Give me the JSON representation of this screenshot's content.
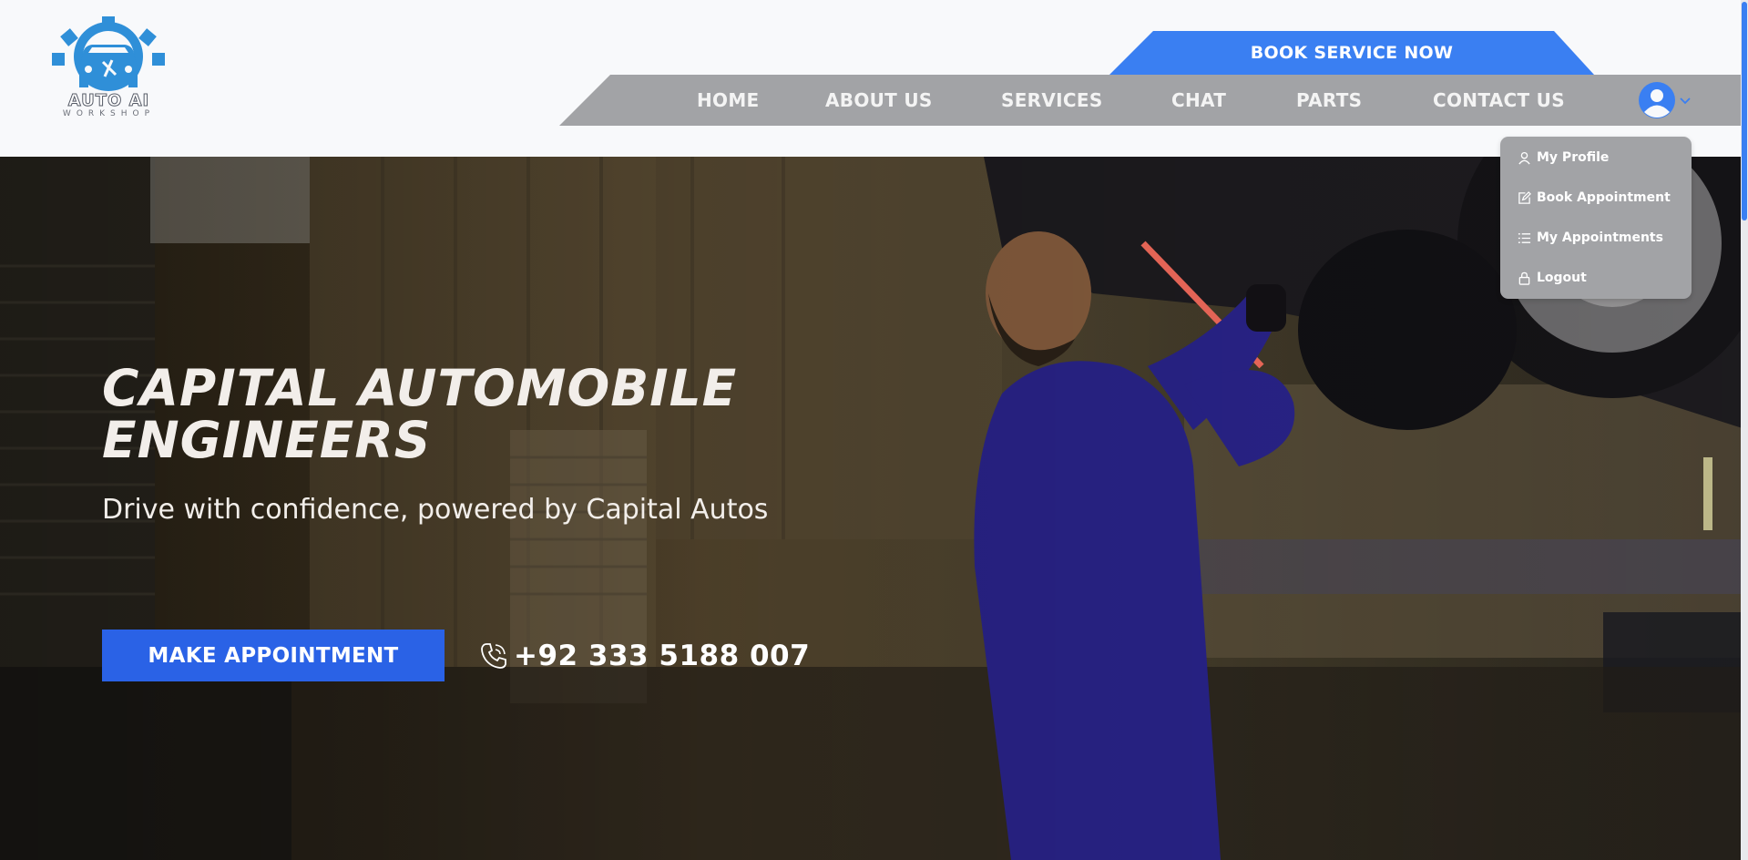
{
  "brand": {
    "name": "AUTO AI",
    "sub": "WORKSHOP",
    "accent": "#3a7ff2"
  },
  "header": {
    "cta": "BOOK SERVICE NOW",
    "nav": [
      {
        "label": "HOME"
      },
      {
        "label": "ABOUT US"
      },
      {
        "label": "SERVICES"
      },
      {
        "label": "CHAT"
      },
      {
        "label": "PARTS"
      },
      {
        "label": "CONTACT US"
      }
    ],
    "user_icon": "user-circle-icon",
    "dropdown": [
      {
        "label": "My Profile",
        "icon": "user-icon"
      },
      {
        "label": "Book Appointment",
        "icon": "edit-icon"
      },
      {
        "label": "My Appointments",
        "icon": "list-icon"
      },
      {
        "label": "Logout",
        "icon": "lock-icon"
      }
    ]
  },
  "hero": {
    "title_line1": "CAPITAL AUTOMOBILE",
    "title_line2": "ENGINEERS",
    "subtitle": "Drive with confidence, powered by Capital Autos",
    "button": "MAKE APPOINTMENT",
    "phone": "+92 333 5188 007",
    "phone_icon": "phone-icon",
    "button_color": "#2a62e6"
  }
}
